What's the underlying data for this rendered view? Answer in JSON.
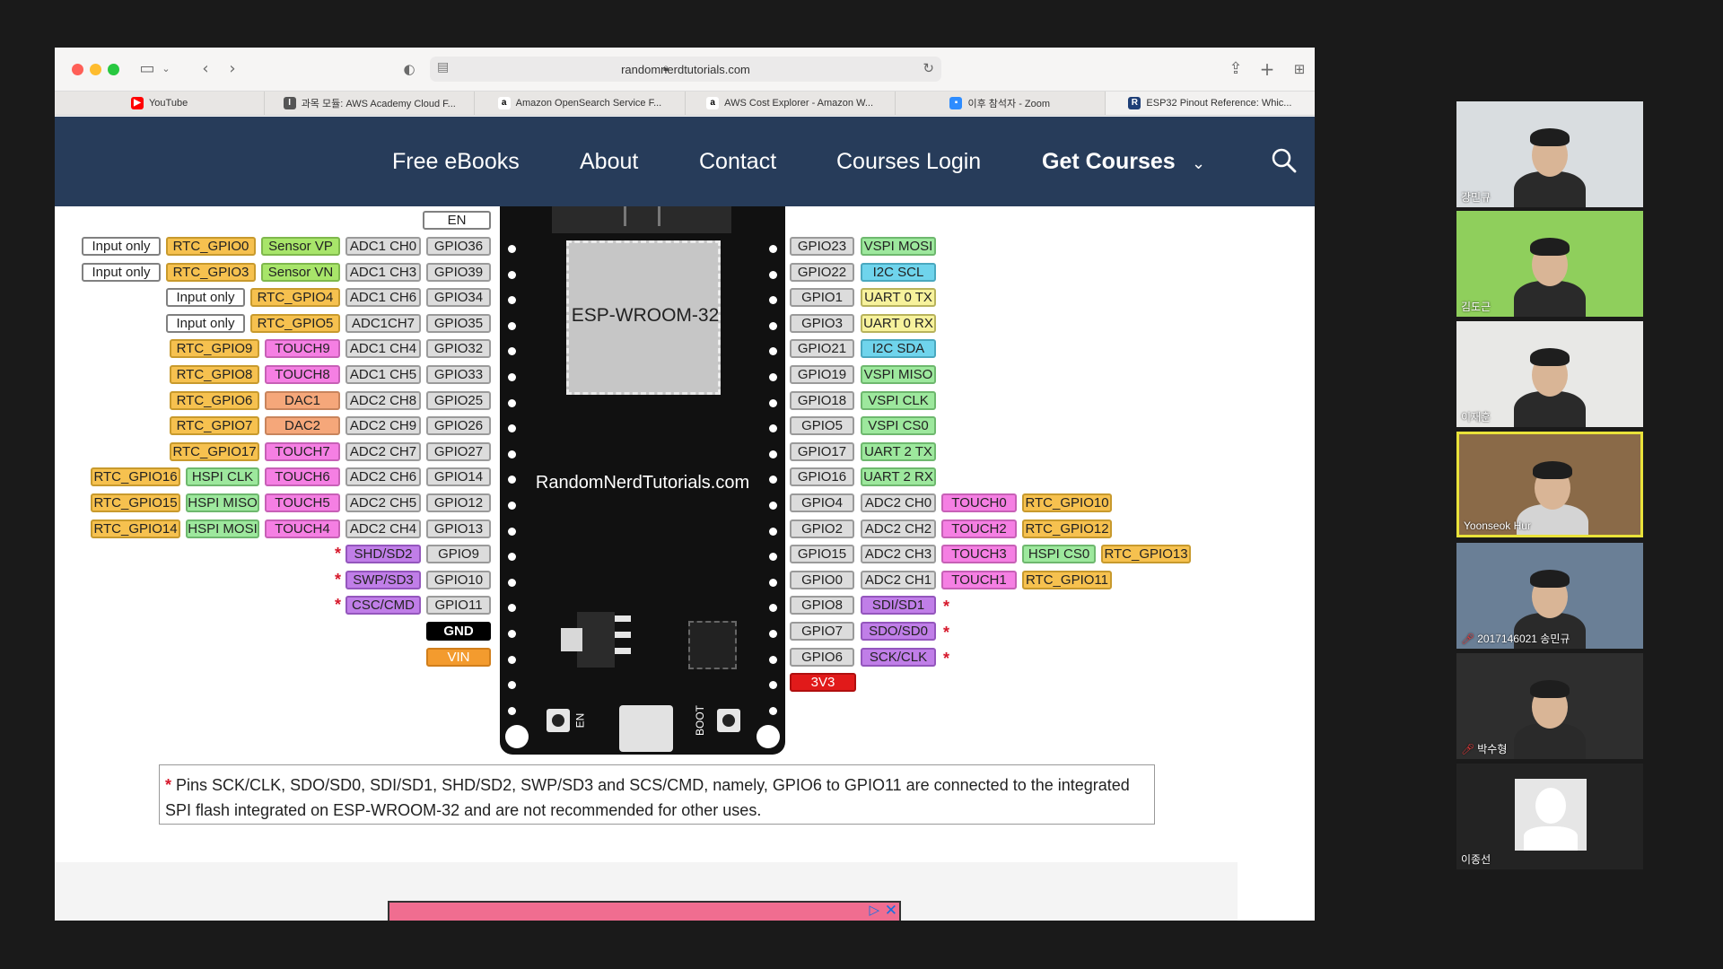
{
  "browser": {
    "address": "randomnerdtutorials.com",
    "tabs": [
      {
        "label": "YouTube",
        "favicon_color": "#ff0000",
        "favicon_glyph": "▶"
      },
      {
        "label": "과목 모듈: AWS Academy Cloud F...",
        "favicon_color": "#555555",
        "favicon_glyph": "I"
      },
      {
        "label": "Amazon OpenSearch Service F...",
        "favicon_color": "#ffffff",
        "favicon_glyph": "a"
      },
      {
        "label": "AWS Cost Explorer - Amazon W...",
        "favicon_color": "#ffffff",
        "favicon_glyph": "a"
      },
      {
        "label": "이후 참석자 - Zoom",
        "favicon_color": "#2d8cff",
        "favicon_glyph": "▪"
      },
      {
        "label": "ESP32 Pinout Reference: Whic...",
        "favicon_color": "#1f3f77",
        "favicon_glyph": "R"
      }
    ]
  },
  "site_nav": {
    "items": [
      "Free eBooks",
      "About",
      "Contact",
      "Courses Login"
    ],
    "get_courses": "Get Courses",
    "accent": "#273c5a"
  },
  "board": {
    "chip_label": "ESP-WROOM-32",
    "brand": "RandomNerdTutorials.com",
    "en_label": "EN",
    "boot_label": "BOOT"
  },
  "pins_left": {
    "en": "EN",
    "rows": [
      {
        "gpio": "GPIO36",
        "labels": [
          "Input only",
          "RTC_GPIO0",
          "Sensor VP",
          "ADC1 CH0"
        ]
      },
      {
        "gpio": "GPIO39",
        "labels": [
          "Input only",
          "RTC_GPIO3",
          "Sensor VN",
          "ADC1 CH3"
        ]
      },
      {
        "gpio": "GPIO34",
        "labels": [
          "Input only",
          "RTC_GPIO4",
          "ADC1 CH6"
        ]
      },
      {
        "gpio": "GPIO35",
        "labels": [
          "Input only",
          "RTC_GPIO5",
          "ADC1CH7"
        ]
      },
      {
        "gpio": "GPIO32",
        "labels": [
          "RTC_GPIO9",
          "TOUCH9",
          "ADC1 CH4"
        ]
      },
      {
        "gpio": "GPIO33",
        "labels": [
          "RTC_GPIO8",
          "TOUCH8",
          "ADC1 CH5"
        ]
      },
      {
        "gpio": "GPIO25",
        "labels": [
          "RTC_GPIO6",
          "DAC1",
          "ADC2 CH8"
        ]
      },
      {
        "gpio": "GPIO26",
        "labels": [
          "RTC_GPIO7",
          "DAC2",
          "ADC2 CH9"
        ]
      },
      {
        "gpio": "GPIO27",
        "labels": [
          "RTC_GPIO17",
          "TOUCH7",
          "ADC2 CH7"
        ]
      },
      {
        "gpio": "GPIO14",
        "labels": [
          "RTC_GPIO16",
          "HSPI CLK",
          "TOUCH6",
          "ADC2 CH6"
        ]
      },
      {
        "gpio": "GPIO12",
        "labels": [
          "RTC_GPIO15",
          "HSPI MISO",
          "TOUCH5",
          "ADC2 CH5"
        ]
      },
      {
        "gpio": "GPIO13",
        "labels": [
          "RTC_GPIO14",
          "HSPI MOSI",
          "TOUCH4",
          "ADC2 CH4"
        ]
      },
      {
        "gpio": "GPIO9",
        "labels": [
          "SHD/SD2"
        ]
      },
      {
        "gpio": "GPIO10",
        "labels": [
          "SWP/SD3"
        ]
      },
      {
        "gpio": "GPIO11",
        "labels": [
          "CSC/CMD"
        ]
      }
    ],
    "gnd": "GND",
    "vin": "VIN"
  },
  "pins_right": {
    "rows": [
      {
        "gpio": "GPIO23",
        "labels": [
          "VSPI MOSI"
        ]
      },
      {
        "gpio": "GPIO22",
        "labels": [
          "I2C SCL"
        ]
      },
      {
        "gpio": "GPIO1",
        "labels": [
          "UART 0 TX"
        ]
      },
      {
        "gpio": "GPIO3",
        "labels": [
          "UART 0 RX"
        ]
      },
      {
        "gpio": "GPIO21",
        "labels": [
          "I2C SDA"
        ]
      },
      {
        "gpio": "GPIO19",
        "labels": [
          "VSPI MISO"
        ]
      },
      {
        "gpio": "GPIO18",
        "labels": [
          "VSPI CLK"
        ]
      },
      {
        "gpio": "GPIO5",
        "labels": [
          "VSPI CS0"
        ]
      },
      {
        "gpio": "GPIO17",
        "labels": [
          "UART 2 TX"
        ]
      },
      {
        "gpio": "GPIO16",
        "labels": [
          "UART 2 RX"
        ]
      },
      {
        "gpio": "GPIO4",
        "labels": [
          "ADC2 CH0",
          "TOUCH0",
          "RTC_GPIO10"
        ]
      },
      {
        "gpio": "GPIO2",
        "labels": [
          "ADC2 CH2",
          "TOUCH2",
          "RTC_GPIO12"
        ]
      },
      {
        "gpio": "GPIO15",
        "labels": [
          "ADC2 CH3",
          "TOUCH3",
          "HSPI CS0",
          "RTC_GPIO13"
        ]
      },
      {
        "gpio": "GPIO0",
        "labels": [
          "ADC2 CH1",
          "TOUCH1",
          "RTC_GPIO11"
        ]
      },
      {
        "gpio": "GPIO8",
        "labels": [
          "SDI/SD1"
        ]
      },
      {
        "gpio": "GPIO7",
        "labels": [
          "SDO/SD0"
        ]
      },
      {
        "gpio": "GPIO6",
        "labels": [
          "SCK/CLK"
        ]
      }
    ],
    "v33": "3V3"
  },
  "note": {
    "star": "*",
    "text": "Pins SCK/CLK, SDO/SD0, SDI/SD1, SHD/SD2, SWP/SD3 and SCS/CMD, namely, GPIO6 to GPIO11 are connected to the integrated SPI flash integrated on ESP-WROOM-32 and are not recommended for other uses."
  },
  "participants": [
    {
      "name": "강민규",
      "muted": false,
      "active": false,
      "bg": "#d9dde0"
    },
    {
      "name": "김도근",
      "muted": false,
      "active": false,
      "bg": "#8fcf5c"
    },
    {
      "name": "이재훈",
      "muted": false,
      "active": false,
      "bg": "#e8e8e6"
    },
    {
      "name": "Yoonseok Hur",
      "muted": false,
      "active": true,
      "bg": "#8a6a48"
    },
    {
      "name": "2017146021 송민규",
      "muted": true,
      "active": false,
      "bg": "#6a7f96"
    },
    {
      "name": "박수형",
      "muted": true,
      "active": false,
      "bg": "#2e2e2e"
    },
    {
      "name": "이종선",
      "muted": false,
      "active": false,
      "bg": "#232323"
    }
  ]
}
